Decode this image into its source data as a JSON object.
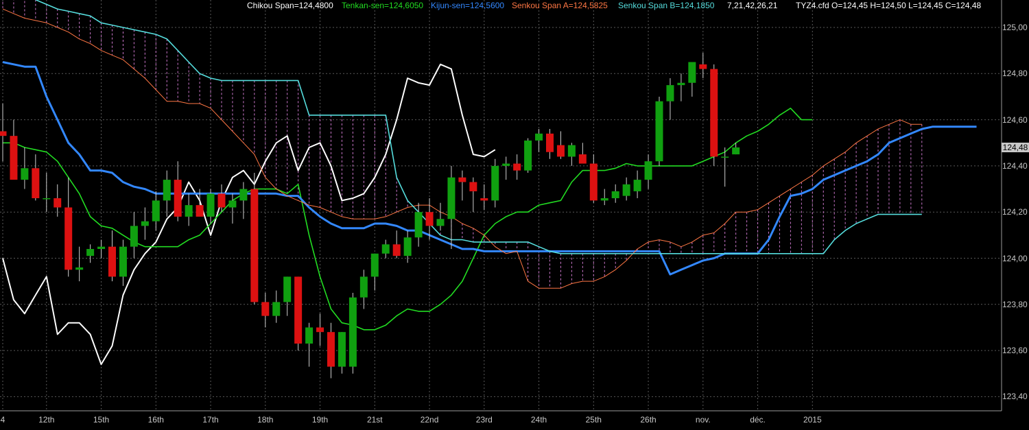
{
  "header": {
    "chikou": "Chikou Span=124,4800",
    "tenkan": "Tenkan-sen=124,6050",
    "kijun": "Kijun-sen=124,5600",
    "senkou_a": "Senkou Span A=124,5825",
    "senkou_b": "Senkou Span B=124,1850",
    "params": "7,21,42,26,21",
    "quote": "TYZ4.cfd O=124,45 H=124,50 L=124,45 C=124,48"
  },
  "last_price_label": "124,48",
  "colors": {
    "background": "#000000",
    "grid": "#5a5a5a",
    "chikou": "#ffffff",
    "tenkan": "#22dd22",
    "kijun": "#3388ff",
    "senkou_a": "#ff7744",
    "senkou_b": "#55dddd",
    "cloud_hatch": "#cc77cc",
    "candle_up": "#10a010",
    "candle_down": "#dd1111",
    "axis_text": "#c8c8c8"
  },
  "chart_data": {
    "type": "candlestick",
    "instrument": "TYZ4.cfd",
    "ylim": [
      123.35,
      125.05
    ],
    "y_ticks": [
      "125,00",
      "124,80",
      "124,60",
      "124,40",
      "124,20",
      "124,00",
      "123,80",
      "123,60",
      "123,40"
    ],
    "y_tick_values": [
      125.0,
      124.8,
      124.6,
      124.4,
      124.2,
      124.0,
      123.8,
      123.6,
      123.4
    ],
    "x_labels": [
      {
        "label": "4",
        "index": 0
      },
      {
        "label": "12th",
        "index": 4
      },
      {
        "label": "15th",
        "index": 9
      },
      {
        "label": "16th",
        "index": 14
      },
      {
        "label": "17th",
        "index": 19
      },
      {
        "label": "18th",
        "index": 24
      },
      {
        "label": "19th",
        "index": 29
      },
      {
        "label": "21st",
        "index": 34
      },
      {
        "label": "22nd",
        "index": 39
      },
      {
        "label": "23rd",
        "index": 44
      },
      {
        "label": "24th",
        "index": 49
      },
      {
        "label": "25th",
        "index": 54
      },
      {
        "label": "26th",
        "index": 59
      },
      {
        "label": "nov.",
        "index": 64
      },
      {
        "label": "déc.",
        "index": 69
      },
      {
        "label": "2015",
        "index": 74
      }
    ],
    "candles": [
      {
        "o": 124.55,
        "h": 124.67,
        "l": 124.42,
        "c": 124.53
      },
      {
        "o": 124.53,
        "h": 124.6,
        "l": 124.35,
        "c": 124.34
      },
      {
        "o": 124.34,
        "h": 124.48,
        "l": 124.3,
        "c": 124.39
      },
      {
        "o": 124.39,
        "h": 124.45,
        "l": 124.25,
        "c": 124.26
      },
      {
        "o": 124.26,
        "h": 124.37,
        "l": 124.2,
        "c": 124.26
      },
      {
        "o": 124.26,
        "h": 124.32,
        "l": 124.18,
        "c": 124.22
      },
      {
        "o": 124.22,
        "h": 124.35,
        "l": 123.92,
        "c": 123.95
      },
      {
        "o": 123.95,
        "h": 124.05,
        "l": 123.9,
        "c": 123.96
      },
      {
        "o": 124.01,
        "h": 124.06,
        "l": 123.98,
        "c": 124.04
      },
      {
        "o": 124.04,
        "h": 124.08,
        "l": 124.0,
        "c": 124.05
      },
      {
        "o": 124.05,
        "h": 124.12,
        "l": 123.9,
        "c": 123.92
      },
      {
        "o": 123.92,
        "h": 124.08,
        "l": 123.88,
        "c": 124.05
      },
      {
        "o": 124.05,
        "h": 124.2,
        "l": 124.0,
        "c": 124.14
      },
      {
        "o": 124.14,
        "h": 124.22,
        "l": 124.08,
        "c": 124.16
      },
      {
        "o": 124.16,
        "h": 124.29,
        "l": 124.12,
        "c": 124.25
      },
      {
        "o": 124.25,
        "h": 124.38,
        "l": 124.18,
        "c": 124.34
      },
      {
        "o": 124.34,
        "h": 124.42,
        "l": 124.16,
        "c": 124.18
      },
      {
        "o": 124.18,
        "h": 124.28,
        "l": 124.14,
        "c": 124.23
      },
      {
        "o": 124.23,
        "h": 124.3,
        "l": 124.2,
        "c": 124.18
      },
      {
        "o": 124.18,
        "h": 124.3,
        "l": 124.15,
        "c": 124.28
      },
      {
        "o": 124.28,
        "h": 124.32,
        "l": 124.2,
        "c": 124.22
      },
      {
        "o": 124.22,
        "h": 124.28,
        "l": 124.15,
        "c": 124.25
      },
      {
        "o": 124.25,
        "h": 124.33,
        "l": 124.17,
        "c": 124.3
      },
      {
        "o": 124.3,
        "h": 124.37,
        "l": 123.8,
        "c": 123.81
      },
      {
        "o": 123.81,
        "h": 123.85,
        "l": 123.7,
        "c": 123.75
      },
      {
        "o": 123.75,
        "h": 123.86,
        "l": 123.72,
        "c": 123.81
      },
      {
        "o": 123.81,
        "h": 123.92,
        "l": 123.75,
        "c": 123.92
      },
      {
        "o": 123.92,
        "h": 123.92,
        "l": 123.6,
        "c": 123.63
      },
      {
        "o": 123.63,
        "h": 123.72,
        "l": 123.53,
        "c": 123.7
      },
      {
        "o": 123.7,
        "h": 123.76,
        "l": 123.62,
        "c": 123.68
      },
      {
        "o": 123.68,
        "h": 123.72,
        "l": 123.48,
        "c": 123.53
      },
      {
        "o": 123.53,
        "h": 123.68,
        "l": 123.5,
        "c": 123.68
      },
      {
        "o": 123.53,
        "h": 123.85,
        "l": 123.5,
        "c": 123.83
      },
      {
        "o": 123.83,
        "h": 123.95,
        "l": 123.78,
        "c": 123.92
      },
      {
        "o": 123.92,
        "h": 124.02,
        "l": 123.86,
        "c": 124.02
      },
      {
        "o": 124.02,
        "h": 124.08,
        "l": 124.0,
        "c": 124.06
      },
      {
        "o": 124.06,
        "h": 124.12,
        "l": 124.0,
        "c": 124.01
      },
      {
        "o": 124.01,
        "h": 124.12,
        "l": 123.98,
        "c": 124.09
      },
      {
        "o": 124.09,
        "h": 124.24,
        "l": 124.05,
        "c": 124.2
      },
      {
        "o": 124.2,
        "h": 124.26,
        "l": 124.08,
        "c": 124.14
      },
      {
        "o": 124.14,
        "h": 124.24,
        "l": 124.12,
        "c": 124.17
      },
      {
        "o": 124.17,
        "h": 124.4,
        "l": 124.04,
        "c": 124.35
      },
      {
        "o": 124.35,
        "h": 124.38,
        "l": 124.25,
        "c": 124.33
      },
      {
        "o": 124.33,
        "h": 124.35,
        "l": 124.2,
        "c": 124.29
      },
      {
        "o": 124.26,
        "h": 124.32,
        "l": 124.21,
        "c": 124.25
      },
      {
        "o": 124.25,
        "h": 124.43,
        "l": 124.22,
        "c": 124.4
      },
      {
        "o": 124.4,
        "h": 124.44,
        "l": 124.34,
        "c": 124.41
      },
      {
        "o": 124.41,
        "h": 124.45,
        "l": 124.34,
        "c": 124.38
      },
      {
        "o": 124.38,
        "h": 124.52,
        "l": 124.37,
        "c": 124.51
      },
      {
        "o": 124.51,
        "h": 124.56,
        "l": 124.46,
        "c": 124.54
      },
      {
        "o": 124.54,
        "h": 124.56,
        "l": 124.43,
        "c": 124.46
      },
      {
        "o": 124.49,
        "h": 124.55,
        "l": 124.43,
        "c": 124.44
      },
      {
        "o": 124.44,
        "h": 124.5,
        "l": 124.4,
        "c": 124.49
      },
      {
        "o": 124.45,
        "h": 124.5,
        "l": 124.42,
        "c": 124.41
      },
      {
        "o": 124.41,
        "h": 124.45,
        "l": 124.24,
        "c": 124.25
      },
      {
        "o": 124.25,
        "h": 124.3,
        "l": 124.23,
        "c": 124.26
      },
      {
        "o": 124.26,
        "h": 124.32,
        "l": 124.24,
        "c": 124.29
      },
      {
        "o": 124.27,
        "h": 124.35,
        "l": 124.25,
        "c": 124.32
      },
      {
        "o": 124.29,
        "h": 124.38,
        "l": 124.26,
        "c": 124.34
      },
      {
        "o": 124.34,
        "h": 124.45,
        "l": 124.3,
        "c": 124.42
      },
      {
        "o": 124.42,
        "h": 124.7,
        "l": 124.4,
        "c": 124.68
      },
      {
        "o": 124.68,
        "h": 124.78,
        "l": 124.6,
        "c": 124.75
      },
      {
        "o": 124.75,
        "h": 124.8,
        "l": 124.68,
        "c": 124.76
      },
      {
        "o": 124.76,
        "h": 124.84,
        "l": 124.7,
        "c": 124.85
      },
      {
        "o": 124.84,
        "h": 124.89,
        "l": 124.78,
        "c": 124.82
      },
      {
        "o": 124.82,
        "h": 124.84,
        "l": 124.4,
        "c": 124.44
      },
      {
        "o": 124.44,
        "h": 124.48,
        "l": 124.31,
        "c": 124.44
      },
      {
        "o": 124.45,
        "h": 124.5,
        "l": 124.45,
        "c": 124.48
      }
    ],
    "series": [
      {
        "name": "Chikou Span",
        "color": "#ffffff",
        "start_index": 0,
        "values": [
          124.0,
          123.82,
          123.76,
          123.84,
          123.92,
          123.67,
          123.72,
          123.72,
          123.67,
          123.54,
          123.62,
          123.84,
          123.95,
          124.02,
          124.07,
          124.17,
          124.22,
          124.33,
          124.25,
          124.1,
          124.25,
          124.35,
          124.38,
          124.32,
          124.42,
          124.5,
          124.53,
          124.38,
          124.48,
          124.5,
          124.4,
          124.25,
          124.26,
          124.28,
          124.35,
          124.45,
          124.6,
          124.78,
          124.76,
          124.75,
          124.84,
          124.82,
          124.62,
          124.45,
          124.44,
          124.47
        ]
      },
      {
        "name": "Tenkan-sen",
        "color": "#22dd22",
        "start_index": 0,
        "values": [
          124.5,
          124.5,
          124.48,
          124.47,
          124.46,
          124.42,
          124.35,
          124.28,
          124.18,
          124.14,
          124.13,
          124.1,
          124.07,
          124.05,
          124.05,
          124.05,
          124.05,
          124.08,
          124.1,
          124.15,
          124.2,
          124.25,
          124.28,
          124.3,
          124.3,
          124.3,
          124.28,
          124.32,
          124.1,
          123.92,
          123.78,
          123.72,
          123.71,
          123.69,
          123.69,
          123.71,
          123.75,
          123.78,
          123.77,
          123.77,
          123.8,
          123.84,
          123.9,
          124.0,
          124.1,
          124.15,
          124.18,
          124.2,
          124.2,
          124.23,
          124.24,
          124.25,
          124.33,
          124.38,
          124.38,
          124.38,
          124.39,
          124.41,
          124.4,
          124.4,
          124.4,
          124.4,
          124.4,
          124.4,
          124.42,
          124.44,
          124.46,
          124.5,
          124.53,
          124.55,
          124.58,
          124.62,
          124.65,
          124.6,
          124.6
        ]
      },
      {
        "name": "Kijun-sen",
        "color": "#3388ff",
        "start_index": 0,
        "values": [
          124.85,
          124.84,
          124.83,
          124.83,
          124.7,
          124.6,
          124.5,
          124.45,
          124.38,
          124.38,
          124.37,
          124.33,
          124.31,
          124.3,
          124.28,
          124.28,
          124.28,
          124.28,
          124.28,
          124.28,
          124.28,
          124.28,
          124.28,
          124.28,
          124.28,
          124.28,
          124.27,
          124.27,
          124.22,
          124.18,
          124.15,
          124.13,
          124.13,
          124.13,
          124.15,
          124.15,
          124.14,
          124.12,
          124.12,
          124.1,
          124.08,
          124.06,
          124.04,
          124.04,
          124.03,
          124.03,
          124.03,
          124.03,
          124.03,
          124.03,
          124.03,
          124.03,
          124.03,
          124.03,
          124.03,
          124.03,
          124.03,
          124.03,
          124.03,
          124.03,
          124.03,
          123.93,
          123.95,
          123.97,
          123.99,
          124.0,
          124.02,
          124.02,
          124.02,
          124.02,
          124.08,
          124.18,
          124.27,
          124.28,
          124.3,
          124.34,
          124.36,
          124.38,
          124.4,
          124.42,
          124.45,
          124.5,
          124.52,
          124.54,
          124.56,
          124.57,
          124.57,
          124.57,
          124.57,
          124.57
        ]
      },
      {
        "name": "Senkou Span A",
        "color": "#ff7744",
        "start_index": 0,
        "values": [
          125.08,
          125.06,
          125.04,
          125.03,
          125.02,
          125.0,
          124.98,
          124.95,
          124.93,
          124.9,
          124.88,
          124.86,
          124.82,
          124.78,
          124.73,
          124.68,
          124.68,
          124.67,
          124.67,
          124.65,
          124.6,
          124.55,
          124.5,
          124.45,
          124.35,
          124.3,
          124.27,
          124.25,
          124.23,
          124.22,
          124.2,
          124.18,
          124.17,
          124.17,
          124.17,
          124.18,
          124.2,
          124.22,
          124.23,
          124.23,
          124.2,
          124.18,
          124.15,
          124.13,
          124.1,
          124.05,
          124.02,
          124.03,
          123.9,
          123.87,
          123.87,
          123.87,
          123.89,
          123.9,
          123.9,
          123.92,
          123.95,
          123.99,
          124.04,
          124.07,
          124.08,
          124.07,
          124.05,
          124.07,
          124.1,
          124.11,
          124.15,
          124.2,
          124.2,
          124.21,
          124.24,
          124.27,
          124.3,
          124.33,
          124.36,
          124.4,
          124.43,
          124.46,
          124.5,
          124.53,
          124.56,
          124.58,
          124.6,
          124.58,
          124.58
        ]
      },
      {
        "name": "Senkou Span B",
        "color": "#55dddd",
        "start_index": 0,
        "values": [
          125.2,
          125.18,
          125.15,
          125.12,
          125.1,
          125.08,
          125.07,
          125.06,
          125.05,
          125.02,
          125.01,
          125.0,
          124.99,
          124.98,
          124.97,
          124.95,
          124.9,
          124.85,
          124.8,
          124.78,
          124.77,
          124.77,
          124.77,
          124.77,
          124.77,
          124.77,
          124.77,
          124.77,
          124.62,
          124.62,
          124.62,
          124.62,
          124.62,
          124.62,
          124.62,
          124.62,
          124.35,
          124.25,
          124.2,
          124.15,
          124.1,
          124.08,
          124.08,
          124.07,
          124.07,
          124.07,
          124.07,
          124.07,
          124.07,
          124.05,
          124.03,
          124.02,
          124.02,
          124.02,
          124.02,
          124.02,
          124.02,
          124.02,
          124.02,
          124.02,
          124.02,
          124.02,
          124.02,
          124.02,
          124.02,
          124.02,
          124.02,
          124.02,
          124.02,
          124.02,
          124.02,
          124.02,
          124.02,
          124.02,
          124.02,
          124.02,
          124.08,
          124.12,
          124.15,
          124.17,
          124.19,
          124.19,
          124.19,
          124.19,
          124.19
        ]
      }
    ],
    "last_price": 124.48
  }
}
